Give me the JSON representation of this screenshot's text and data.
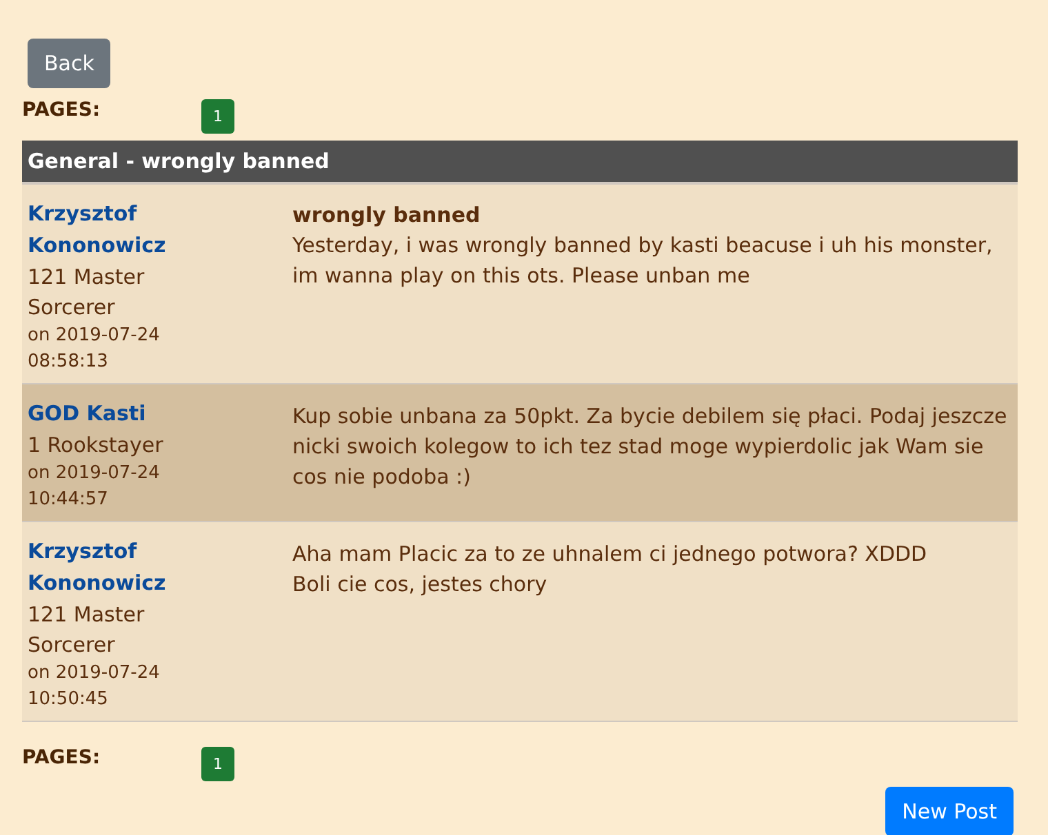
{
  "back_button": "Back",
  "pages_top": {
    "label": "PAGES:",
    "pages": [
      {
        "label": "1",
        "selected": true
      }
    ]
  },
  "thread_title": "General - wrongly banned",
  "posts": [
    {
      "author": "Krzysztof Kononowicz",
      "rank": "121 Master Sorcerer",
      "date": "on 2019-07-24 08:58:13",
      "title": "wrongly banned",
      "body": [
        "Yesterday, i was wrongly banned by kasti beacuse i uh his monster, im wanna play on this ots. Please unban me"
      ]
    },
    {
      "author": "GOD Kasti",
      "rank": "1 Rookstayer",
      "date": "on 2019-07-24 10:44:57",
      "body": [
        "Kup sobie unbana za 50pkt. Za bycie debilem się płaci. Podaj jeszcze nicki swoich kolegow to ich tez stad moge wypierdolic jak Wam sie cos nie podoba :)"
      ]
    },
    {
      "author": "Krzysztof Kononowicz",
      "rank": "121 Master Sorcerer",
      "date": "on 2019-07-24 10:50:45",
      "body": [
        "Aha mam Placic za to ze uhnalem ci jednego potwora? XDDD",
        "Boli cie cos, jestes chory"
      ]
    }
  ],
  "pages_bottom": {
    "label": "PAGES:",
    "pages": [
      {
        "label": "1",
        "selected": true
      }
    ]
  },
  "new_post_button": "New Post"
}
